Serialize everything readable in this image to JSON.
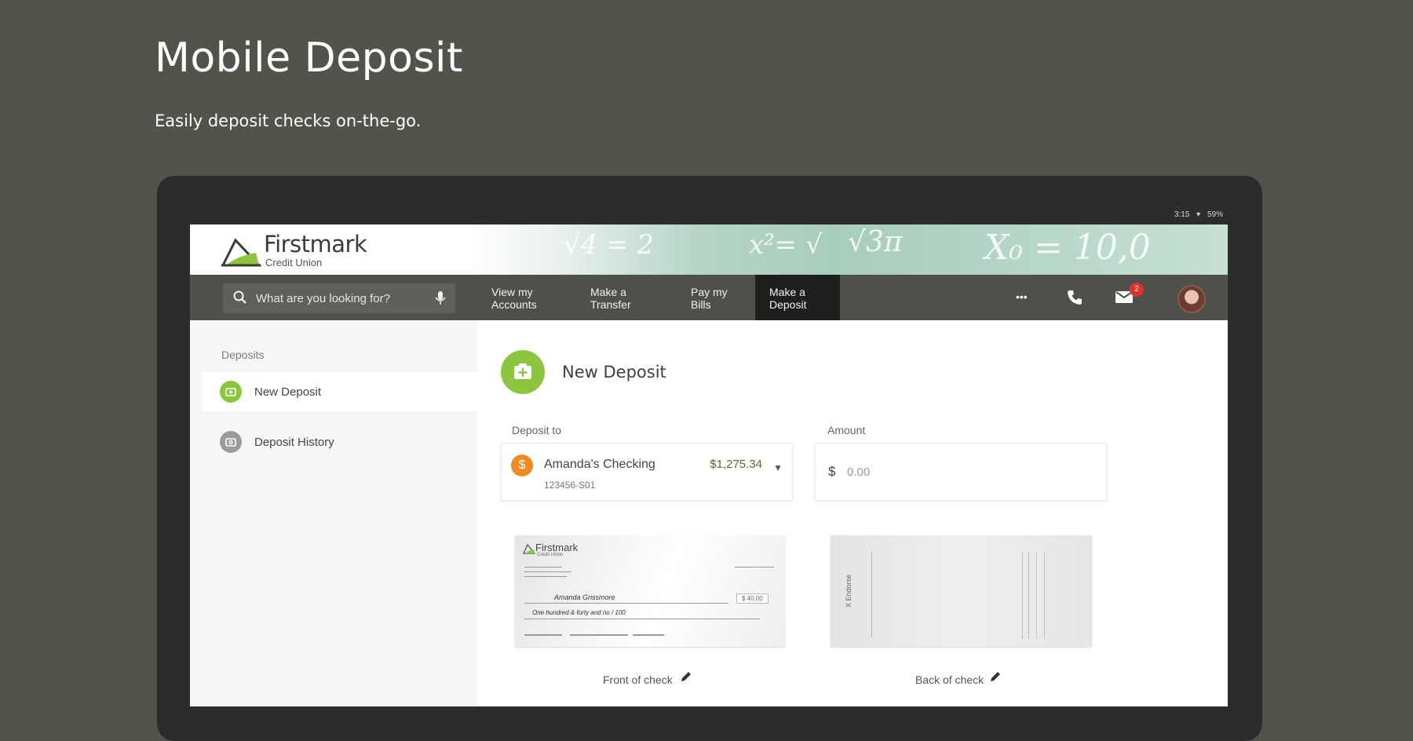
{
  "promo": {
    "title": "Mobile Deposit",
    "subtitle": "Easily deposit checks on-the-go."
  },
  "status_bar": {
    "time": "3:15",
    "battery": "59%"
  },
  "header": {
    "logo_name": "Firstmark",
    "logo_tagline": "Credit Union",
    "chalk_1": "√4 = 2",
    "chalk_2": "x²= √",
    "chalk_3": "√3π",
    "chalk_4": "X₀ = 10,0"
  },
  "nav": {
    "search_placeholder": "What are you looking for?",
    "links": [
      {
        "line1": "View my",
        "line2": "Accounts"
      },
      {
        "line1": "Make a",
        "line2": "Transfer"
      },
      {
        "line1": "Pay my",
        "line2": "Bills"
      },
      {
        "line1": "Make a",
        "line2": "Deposit"
      }
    ],
    "more_label": "•••",
    "message_count": "2"
  },
  "sidebar": {
    "heading": "Deposits",
    "items": [
      {
        "label": "New Deposit",
        "active": true
      },
      {
        "label": "Deposit History",
        "active": false
      }
    ]
  },
  "main": {
    "title": "New Deposit",
    "deposit_to_label": "Deposit to",
    "amount_label": "Amount",
    "account": {
      "icon": "$",
      "name": "Amanda's Checking",
      "number": "123456-S01",
      "balance": "$1,275.34"
    },
    "amount": {
      "currency": "$",
      "value": "0.00"
    },
    "front_caption": "Front of check",
    "back_caption": "Back of check",
    "check": {
      "bank_name": "Firstmark",
      "bank_sub": "Credit Union",
      "payee": "Amanda Grissmore",
      "amount": "$ 40.00",
      "memo": "One hundred & forty and no / 100",
      "endorse": "X Endorse"
    }
  },
  "colors": {
    "brand_green": "#8cc63f",
    "nav_bg": "#4f5049",
    "account_orange": "#f08a24",
    "badge_red": "#d9342b"
  }
}
